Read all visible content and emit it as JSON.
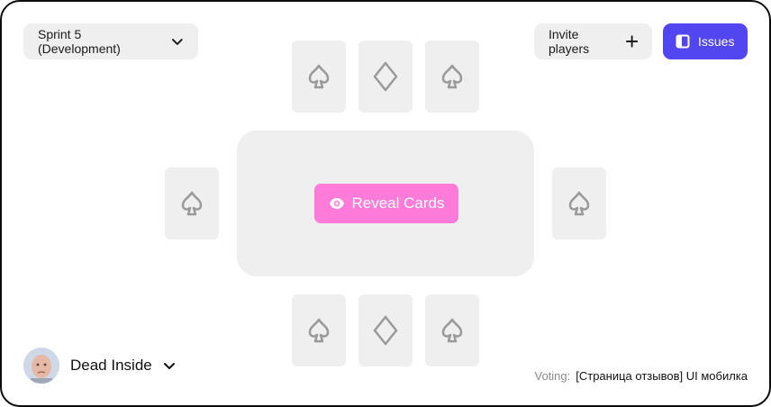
{
  "header": {
    "sprint_selector": {
      "label": "Sprint 5 (Development)",
      "icon": "chevron-down-icon"
    },
    "invite_button": {
      "label": "Invite players",
      "icon": "plus-icon"
    },
    "issues_button": {
      "label": "Issues",
      "icon": "sidebar-panel-icon"
    }
  },
  "table": {
    "reveal_button": {
      "label": "Reveal Cards",
      "icon": "eye-icon"
    },
    "cards_top": [
      "spade-icon",
      "diamond-icon",
      "spade-icon"
    ],
    "cards_left": [
      "spade-icon"
    ],
    "cards_right": [
      "spade-icon"
    ],
    "cards_bottom": [
      "spade-icon",
      "diamond-icon",
      "spade-icon"
    ]
  },
  "user": {
    "name": "Dead Inside",
    "icon": "chevron-down-icon"
  },
  "voting": {
    "label": "Voting:",
    "value": "[Страница отзывов] UI мобилка"
  },
  "colors": {
    "accent": "#5146f0",
    "reveal": "#ff7bd9",
    "card": "#efefef",
    "border": "#0b0b0b"
  }
}
